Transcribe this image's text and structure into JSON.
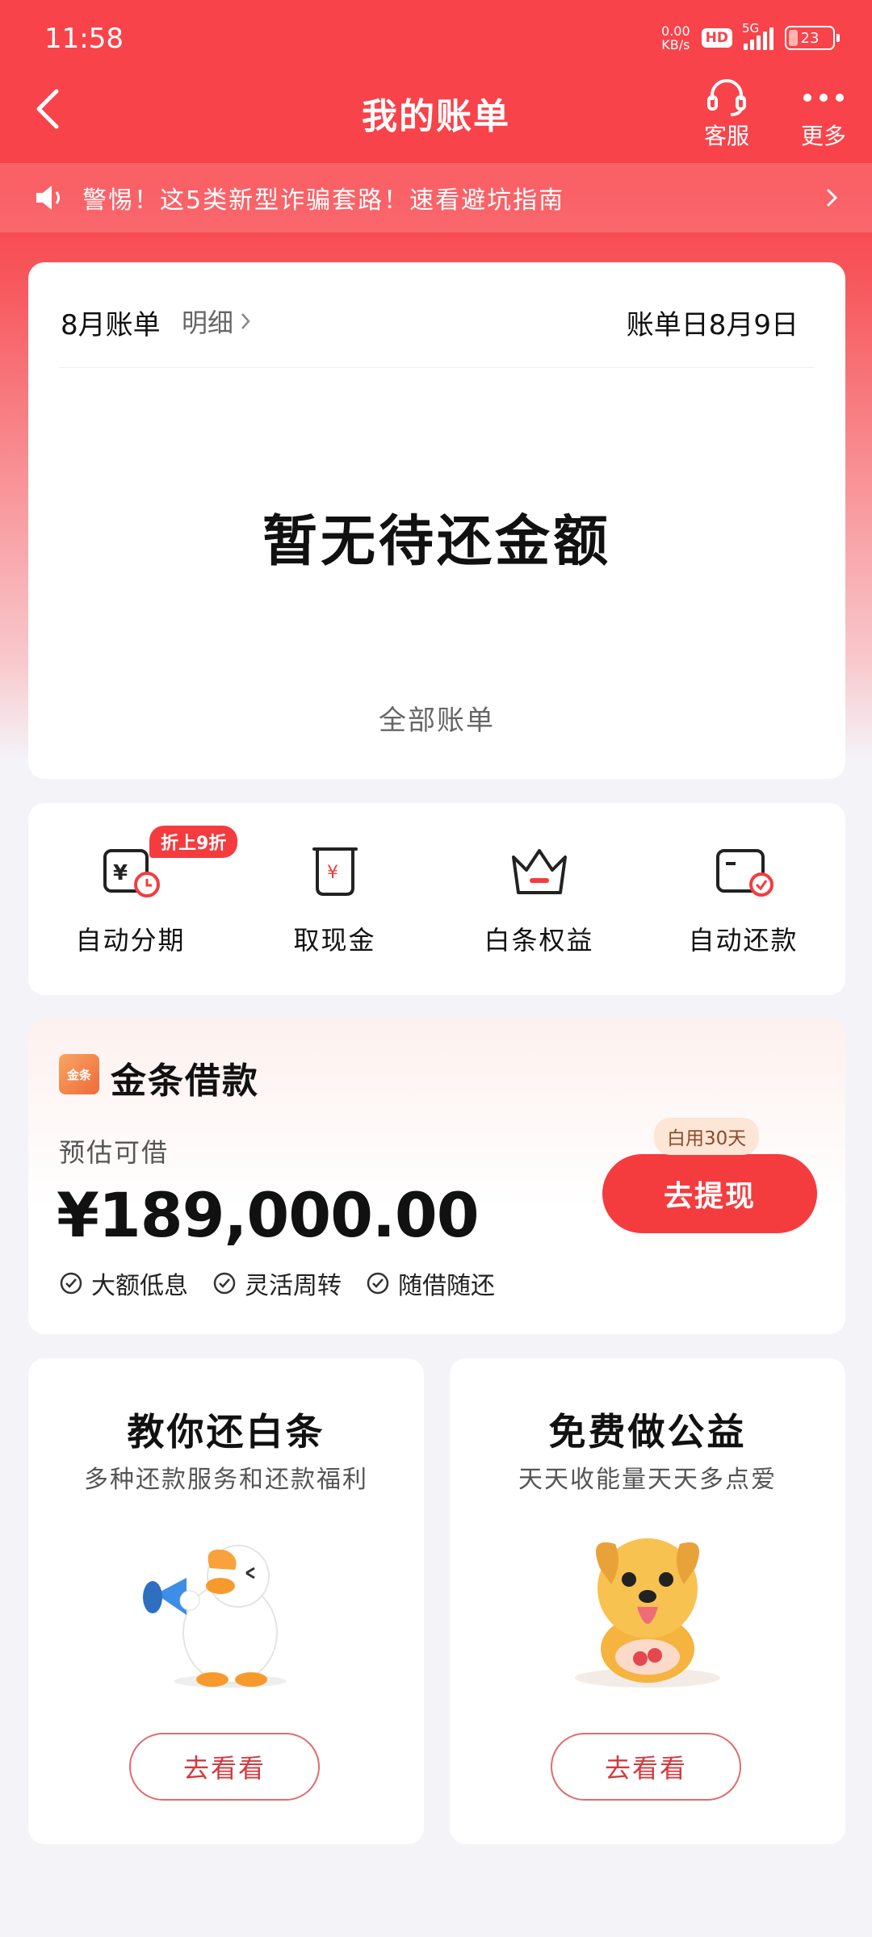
{
  "status_bar": {
    "time": "11:58",
    "net_speed_value": "0.00",
    "net_speed_unit": "KB/s",
    "hd": "HD",
    "network": "5G",
    "battery": "23",
    "battery_level": 0.23
  },
  "header": {
    "title": "我的账单",
    "service_label": "客服",
    "more_label": "更多",
    "back_icon": "back-icon",
    "service_icon": "headset-icon",
    "more_icon": "more-icon"
  },
  "notice": {
    "text": "警惕！这5类新型诈骗套路！速看避坑指南",
    "icon": "speaker-icon"
  },
  "bill": {
    "month_label": "8月账单",
    "detail_label": "明细",
    "bill_day": "账单日8月9日",
    "empty_text": "暂无待还金额",
    "all_bills_label": "全部账单"
  },
  "quick_actions": [
    {
      "label": "自动分期",
      "icon": "auto-installment-icon",
      "tag": "折上9折"
    },
    {
      "label": "取现金",
      "icon": "cash-withdraw-icon"
    },
    {
      "label": "白条权益",
      "icon": "crown-icon"
    },
    {
      "label": "自动还款",
      "icon": "auto-repay-icon"
    }
  ],
  "loan": {
    "logo_text": "金条",
    "title": "金条借款",
    "subtitle": "预估可借",
    "amount": "¥189,000.00",
    "features": [
      "大额低息",
      "灵活周转",
      "随借随还"
    ],
    "badge": "白用30天",
    "button": "去提现"
  },
  "promos": [
    {
      "title": "教你还白条",
      "subtitle": "多种还款服务和还款福利",
      "button": "去看看",
      "image": "duck-mascot"
    },
    {
      "title": "免费做公益",
      "subtitle": "天天收能量天天多点爱",
      "button": "去看看",
      "image": "dog-mascot"
    }
  ],
  "colors": {
    "brand_red": "#f8434a",
    "button_red": "#f43c3f",
    "page_bg": "#f4f3f8"
  }
}
